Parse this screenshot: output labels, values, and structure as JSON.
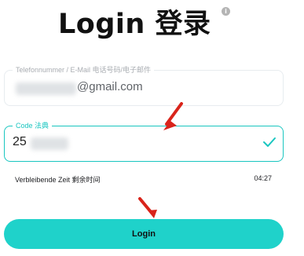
{
  "page": {
    "title": "Login  登录",
    "info_icon": "info-icon"
  },
  "form": {
    "phone_email": {
      "label": "Telefonnummer / E-Mail 电话号码/电子邮件",
      "value_visible": "@gmail.com",
      "has_redacted_prefix": true
    },
    "code": {
      "label": "Code 法典",
      "value_visible": "25",
      "has_redacted_suffix": true,
      "status_icon": "check-icon"
    }
  },
  "timer": {
    "label": "Verbleibende Zeit  剩余时间",
    "value": "04:27"
  },
  "actions": {
    "login_label": "Login"
  },
  "annotations": {
    "arrow_icon": "red-arrow-icon",
    "arrow_color": "#d9241b"
  },
  "colors": {
    "accent": "#19c6c0",
    "button": "#1fd2ca",
    "redaction": "#dfe2e5"
  }
}
